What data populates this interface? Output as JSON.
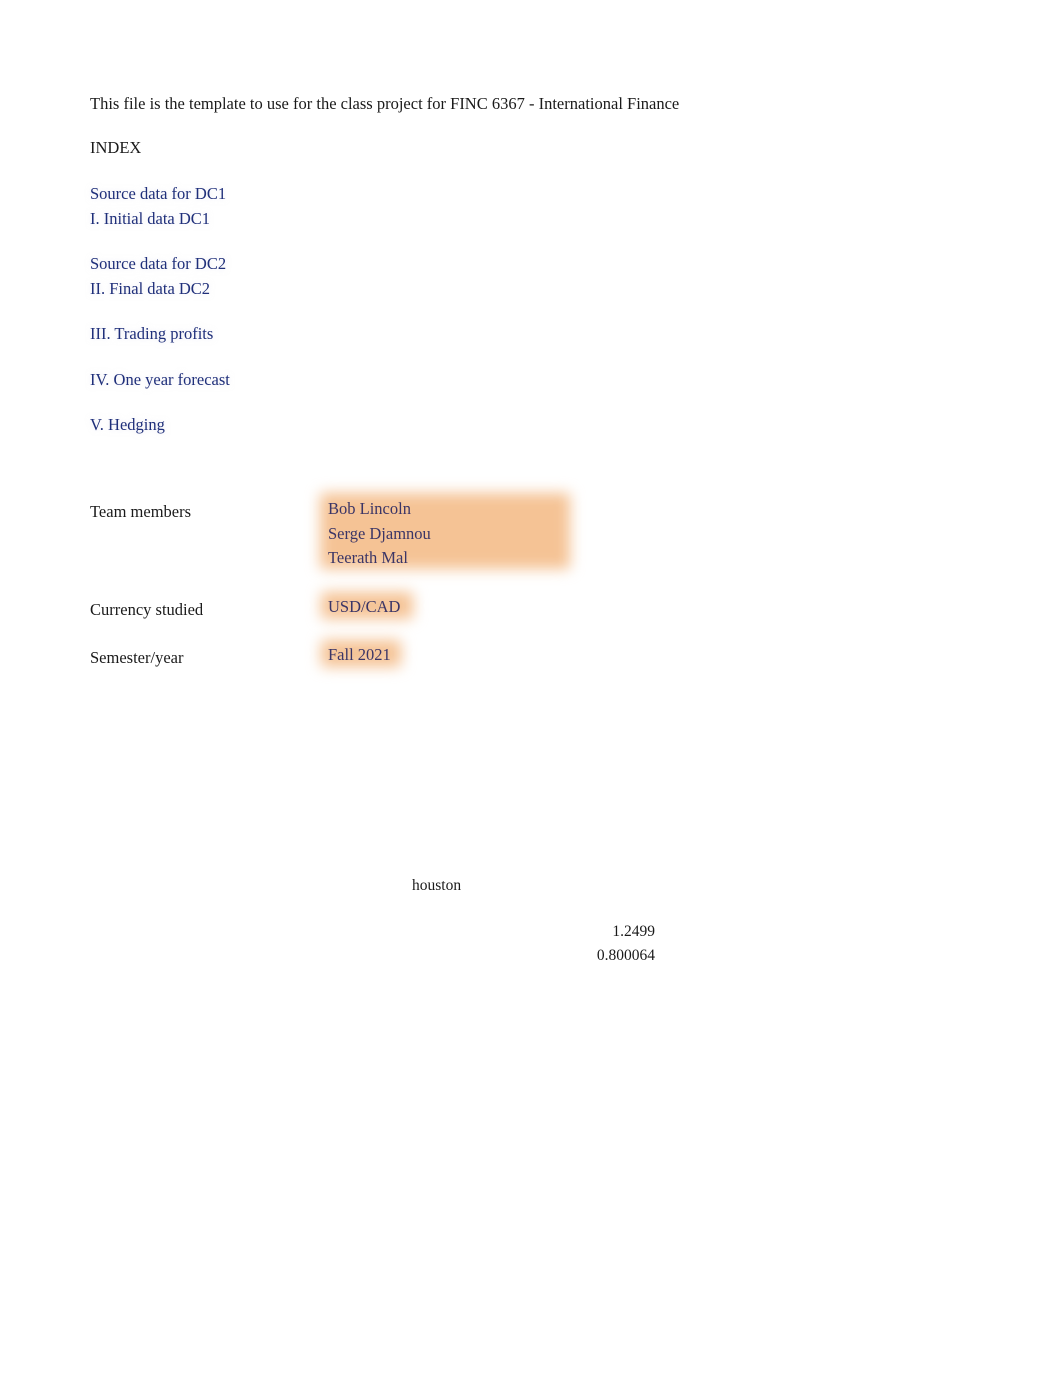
{
  "document": {
    "header_line": "This file is the template to use for the class project for FINC 6367 - International Finance",
    "index_heading": "INDEX"
  },
  "index": {
    "groups": [
      {
        "links": [
          {
            "label": "Source data for DC1"
          },
          {
            "label": "I. Initial data DC1"
          }
        ]
      },
      {
        "links": [
          {
            "label": "Source data for DC2"
          },
          {
            "label": "II. Final data DC2"
          }
        ]
      },
      {
        "links": [
          {
            "label": "III. Trading profits"
          }
        ]
      },
      {
        "links": [
          {
            "label": "IV. One year forecast"
          }
        ]
      },
      {
        "links": [
          {
            "label": "V. Hedging"
          }
        ]
      }
    ]
  },
  "info": {
    "team_members_label": "Team members",
    "team_members": [
      "Bob Lincoln",
      "Serge Djamnou",
      "Teerath Mal"
    ],
    "currency_label": "Currency studied",
    "currency_value": "USD/CAD",
    "semester_label": "Semester/year",
    "semester_value": "Fall 2021"
  },
  "lower_section": {
    "note": "houston",
    "values": [
      "1.2499",
      "0.800064"
    ]
  },
  "colors": {
    "highlight": "#f5c395",
    "link_text": "#1f2f7a",
    "value_text": "#3b3566",
    "body_text": "#1a1a1a",
    "page_background": "#ffffff"
  }
}
